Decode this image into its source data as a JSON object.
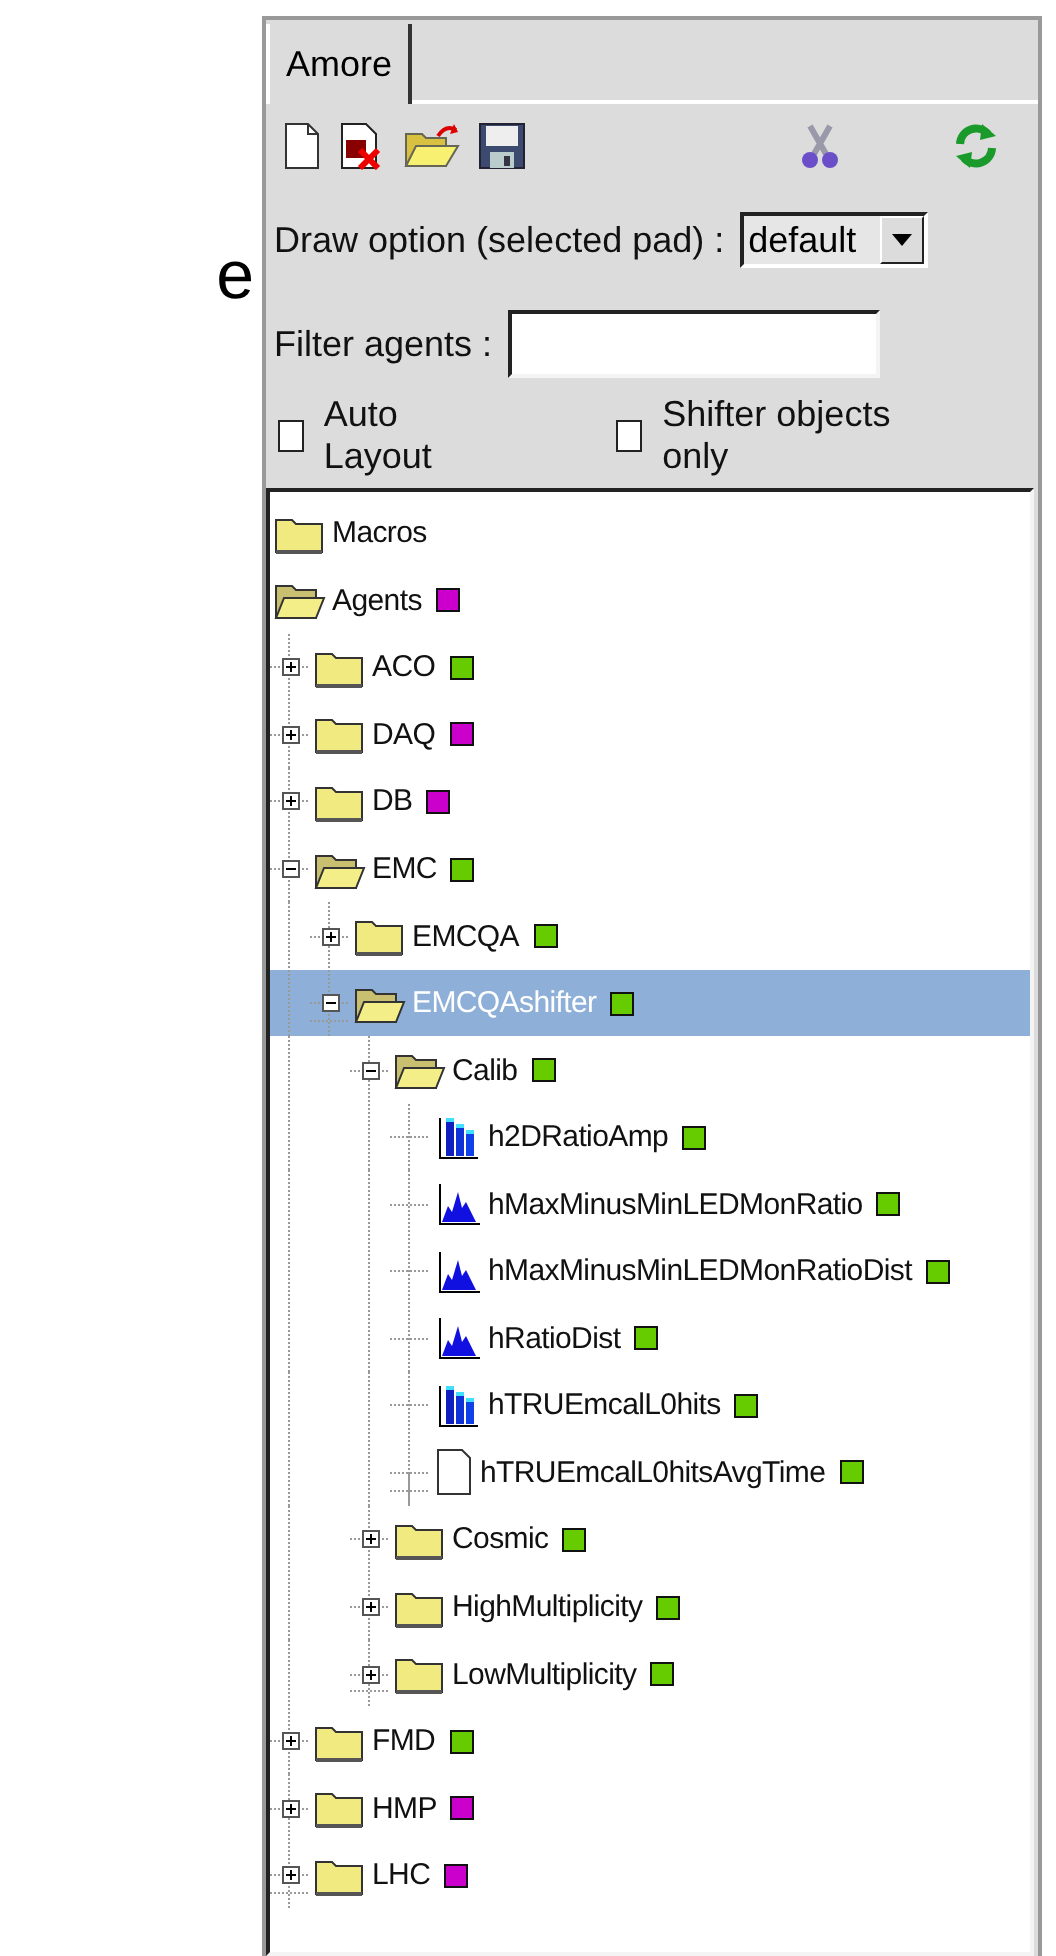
{
  "slide_text": "e",
  "tab": {
    "label": "Amore",
    "selected": true
  },
  "draw_option": {
    "label": "Draw option (selected pad) :",
    "value": "default"
  },
  "filter": {
    "label": "Filter agents :"
  },
  "checkboxes": [
    {
      "label": "Auto Layout",
      "checked": false
    },
    {
      "label": "Shifter objects only",
      "checked": false
    }
  ],
  "tree": [
    {
      "label": "Macros",
      "kind": "folder",
      "expanded": false,
      "selected": false
    },
    {
      "label": "Agents",
      "kind": "folder",
      "expanded": true,
      "selected": false,
      "color": "#cc00cc",
      "children": [
        {
          "label": "ACO",
          "kind": "folder",
          "expanded": false,
          "selected": false,
          "color": "#66cc00"
        },
        {
          "label": "DAQ",
          "kind": "folder",
          "expanded": false,
          "selected": false,
          "color": "#cc00cc"
        },
        {
          "label": "DB",
          "kind": "folder",
          "expanded": false,
          "selected": false,
          "color": "#cc00cc"
        },
        {
          "label": "EMC",
          "kind": "folder",
          "expanded": true,
          "selected": false,
          "color": "#66cc00",
          "children": [
            {
              "label": "EMCQA",
              "kind": "folder",
              "expanded": false,
              "selected": false,
              "color": "#66cc00"
            },
            {
              "label": "EMCQAshifter",
              "kind": "folder",
              "expanded": true,
              "selected": true,
              "color": "#66cc00",
              "children": [
                {
                  "label": "Calib",
                  "kind": "folder",
                  "expanded": true,
                  "selected": false,
                  "color": "#66cc00",
                  "children": [
                    {
                      "label": "h2DRatioAmp",
                      "kind": "hist2d",
                      "selected": false,
                      "color": "#66cc00"
                    },
                    {
                      "label": "hMaxMinusMinLEDMonRatio",
                      "kind": "hist1d",
                      "selected": false,
                      "color": "#66cc00"
                    },
                    {
                      "label": "hMaxMinusMinLEDMonRatioDist",
                      "kind": "hist1d",
                      "selected": false,
                      "color": "#66cc00"
                    },
                    {
                      "label": "hRatioDist",
                      "kind": "hist1d",
                      "selected": false,
                      "color": "#66cc00"
                    },
                    {
                      "label": "hTRUEmcalL0hits",
                      "kind": "hist2d",
                      "selected": false,
                      "color": "#66cc00"
                    },
                    {
                      "label": "hTRUEmcalL0hitsAvgTime",
                      "kind": "object",
                      "selected": false,
                      "color": "#66cc00"
                    }
                  ]
                },
                {
                  "label": "Cosmic",
                  "kind": "folder",
                  "expanded": false,
                  "selected": false,
                  "color": "#66cc00"
                },
                {
                  "label": "HighMultiplicity",
                  "kind": "folder",
                  "expanded": false,
                  "selected": false,
                  "color": "#66cc00"
                },
                {
                  "label": "LowMultiplicity",
                  "kind": "folder",
                  "expanded": false,
                  "selected": false,
                  "color": "#66cc00"
                }
              ]
            }
          ]
        },
        {
          "label": "FMD",
          "kind": "folder",
          "expanded": false,
          "selected": false,
          "color": "#66cc00"
        },
        {
          "label": "HMP",
          "kind": "folder",
          "expanded": false,
          "selected": false,
          "color": "#cc00cc"
        },
        {
          "label": "LHC",
          "kind": "folder",
          "expanded": false,
          "selected": false,
          "color": "#cc00cc"
        }
      ]
    }
  ]
}
